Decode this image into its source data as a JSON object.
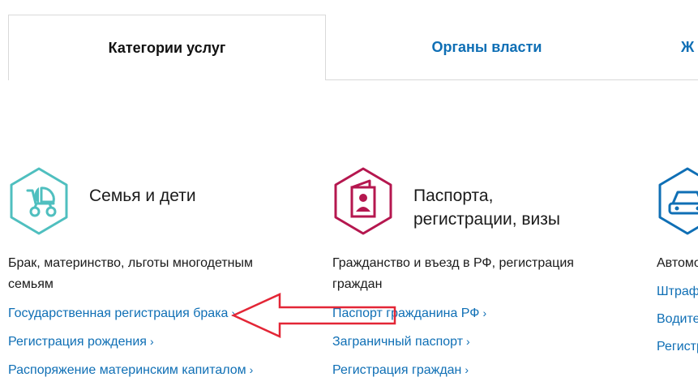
{
  "tabs": [
    {
      "label": "Категории услуг",
      "active": true
    },
    {
      "label": "Органы власти",
      "active": false
    },
    {
      "label": "Ж",
      "active": false
    }
  ],
  "categories": [
    {
      "icon": "baby-stroller-icon",
      "color": "#4fbfbf",
      "title_line1": "Семья и дети",
      "title_line2": "",
      "description": "Брак, материнство, льготы многодетным семьям",
      "links": [
        "Государственная регистрация брака",
        "Регистрация рождения",
        "Распоряжение материнским капиталом"
      ]
    },
    {
      "icon": "passport-icon",
      "color": "#b5174f",
      "title_line1": "Паспорта,",
      "title_line2": "регистрации, визы",
      "description": "Гражданство и въезд в РФ, регистрация граждан",
      "links": [
        "Паспорт гражданина РФ",
        "Заграничный паспорт",
        "Регистрация граждан"
      ]
    },
    {
      "icon": "car-icon",
      "color": "#0f6fb5",
      "title_line1": "",
      "title_line2": "",
      "description": "Автомо трансп",
      "links": [
        "Штраф",
        "Водите",
        "Регистр"
      ]
    }
  ],
  "link_chevron": "›",
  "colors": {
    "link": "#0f6fb5",
    "arrow": "#e32636",
    "border": "#d9d9d9"
  }
}
